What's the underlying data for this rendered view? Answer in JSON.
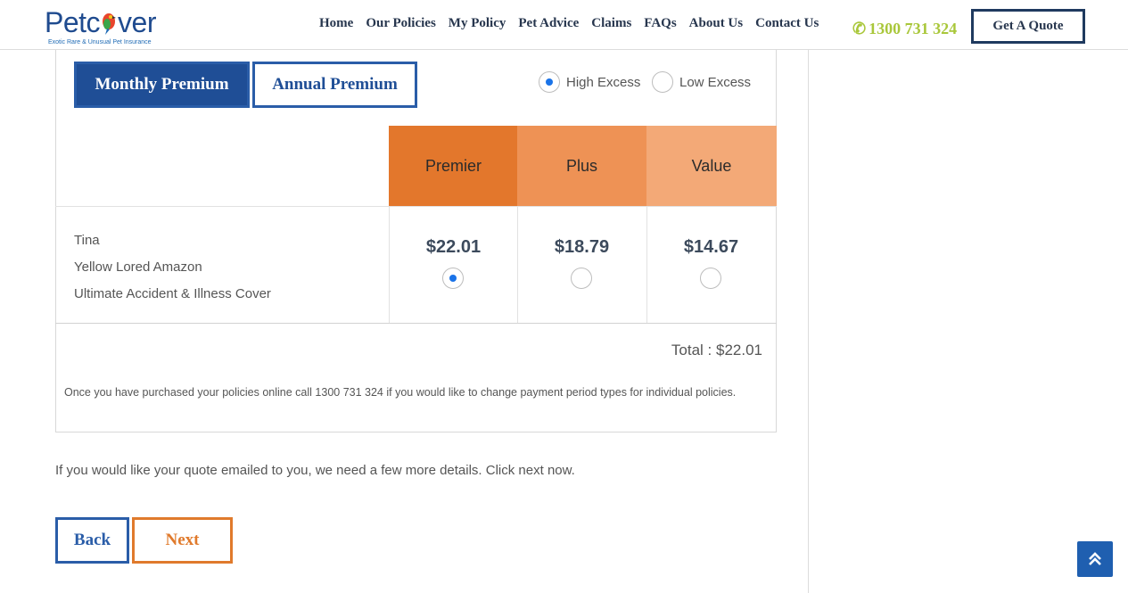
{
  "header": {
    "logo_text": "Petcover",
    "logo_tagline": "Exotic Rare & Unusual Pet Insurance",
    "nav": [
      "Home",
      "Our Policies",
      "My Policy",
      "Pet Advice",
      "Claims",
      "FAQs",
      "About Us",
      "Contact Us"
    ],
    "phone": "1300 731 324",
    "quote_button": "Get A Quote"
  },
  "premium_toggle": {
    "monthly": "Monthly Premium",
    "annual": "Annual Premium",
    "selected": "monthly"
  },
  "excess": {
    "high": "High Excess",
    "low": "Low Excess",
    "selected": "high"
  },
  "plans": [
    {
      "name": "Premier",
      "price": "$22.01",
      "selected": true,
      "color": "#e3772c"
    },
    {
      "name": "Plus",
      "price": "$18.79",
      "selected": false,
      "color": "#ee9255"
    },
    {
      "name": "Value",
      "price": "$14.67",
      "selected": false,
      "color": "#f3a977"
    }
  ],
  "pet": {
    "name": "Tina",
    "breed": "Yellow Lored Amazon",
    "cover": "Ultimate Accident & Illness Cover"
  },
  "total": "Total : $22.01",
  "note": "Once you have purchased your policies online call 1300 731 324 if you would like to change payment period types for individual policies.",
  "email_prompt": "If you would like your quote emailed to you, we need a few more details. Click next now.",
  "buttons": {
    "back": "Back",
    "next": "Next"
  },
  "colors": {
    "brand_blue": "#1f4e96",
    "accent_orange": "#e07a2c",
    "phone_green": "#a9c73a"
  }
}
